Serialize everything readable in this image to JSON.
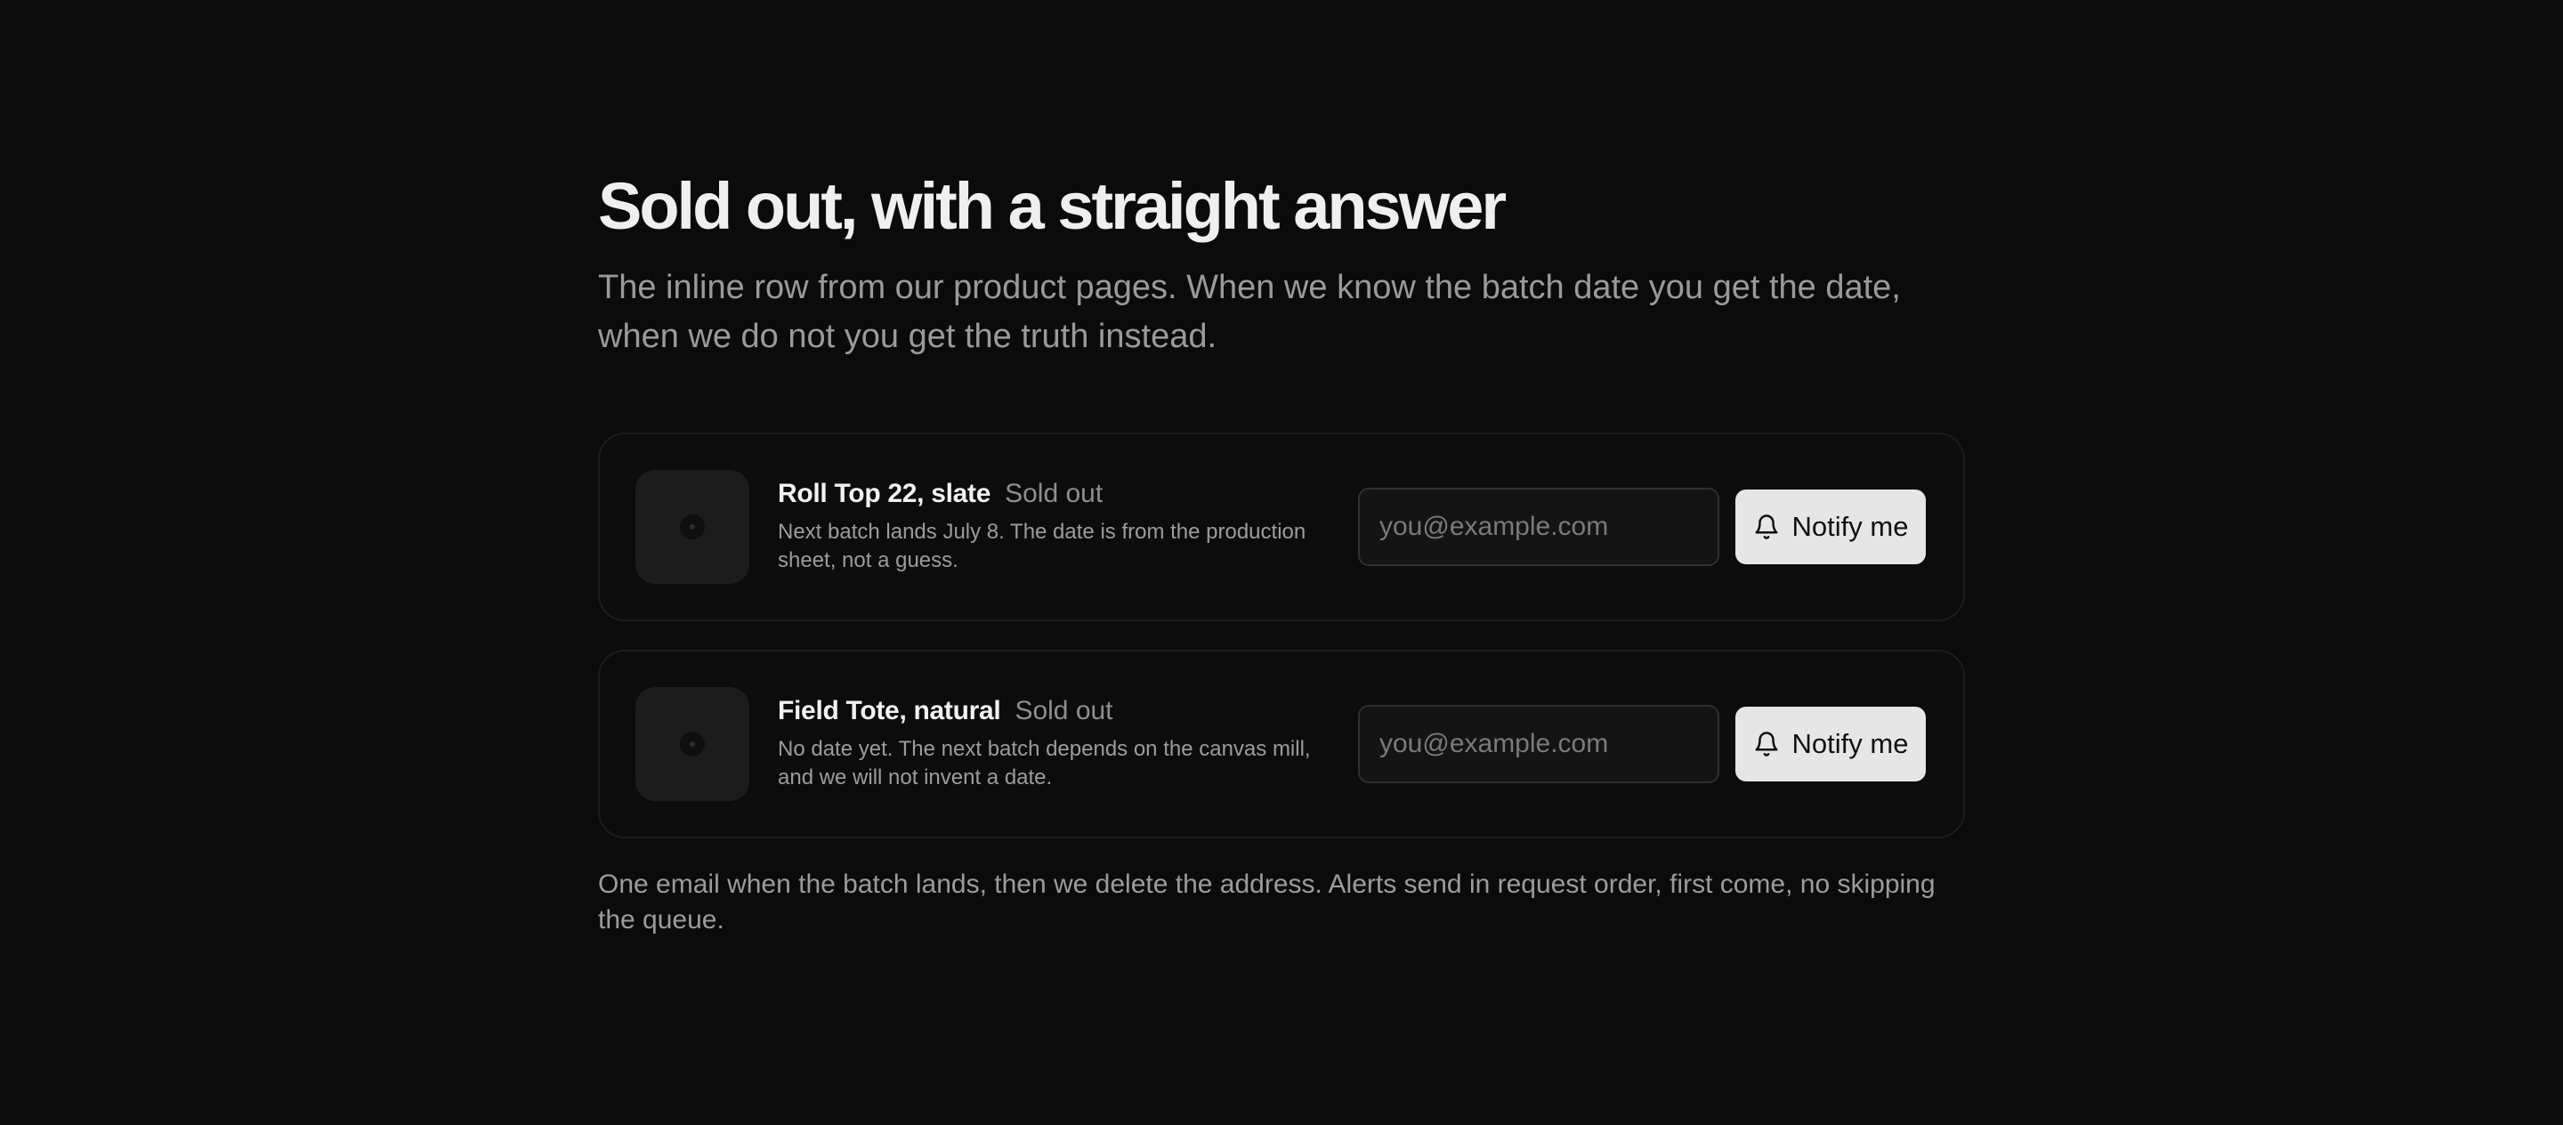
{
  "header": {
    "title": "Sold out, with a straight answer",
    "subtitle": "The inline row from our product pages. When we know the batch date you get the date, when we do not you get the truth instead."
  },
  "products": [
    {
      "name": "Roll Top 22, slate",
      "status": "Sold out",
      "description": "Next batch lands July 8. The date is from the production sheet, not a guess.",
      "email_placeholder": "you@example.com",
      "email_value": "",
      "button_label": "Notify me",
      "button_icon": "bell-icon"
    },
    {
      "name": "Field Tote, natural",
      "status": "Sold out",
      "description": "No date yet. The next batch depends on the canvas mill, and we will not invent a date.",
      "email_placeholder": "you@example.com",
      "email_value": "",
      "button_label": "Notify me",
      "button_icon": "bell-icon"
    }
  ],
  "footnote": "One email when the batch lands, then we delete the address. Alerts send in request order, first come, no skipping the queue.",
  "colors": {
    "background": "#0b0b0b",
    "card_border": "#1c1c1c",
    "button_bg": "#e6e6e6",
    "muted_text": "#9c9c9c"
  }
}
